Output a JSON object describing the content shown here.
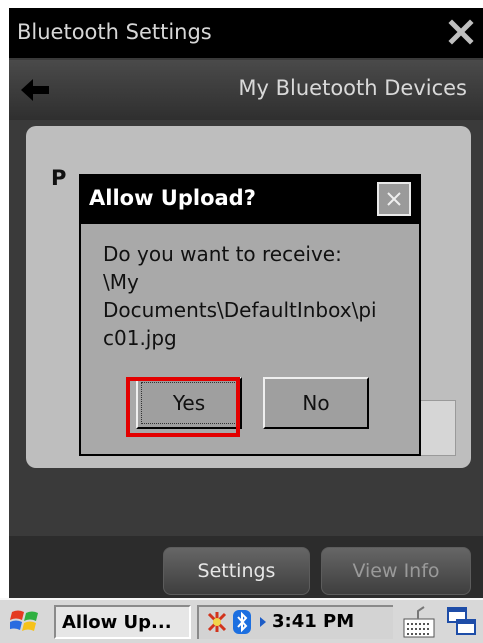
{
  "window": {
    "title": "Bluetooth Settings",
    "close_icon": "close-icon"
  },
  "header": {
    "back_icon": "back-arrow-icon",
    "title": "My Bluetooth Devices"
  },
  "background_panel": {
    "partial_label": "P"
  },
  "dialog": {
    "title": "Allow Upload?",
    "message_lines": [
      "Do you want to receive:",
      "\\My",
      "Documents\\DefaultInbox\\pi",
      "c01.jpg"
    ],
    "yes_label": "Yes",
    "no_label": "No",
    "highlight_color": "#e30000"
  },
  "toolbar": {
    "settings_label": "Settings",
    "viewinfo_label": "View Info"
  },
  "taskbar": {
    "start_icon": "windows-flag-icon",
    "task_label": "Allow Up...",
    "time": "3:41 PM",
    "keyboard_icon": "keyboard-icon",
    "multitask_icon": "windows-switch-icon"
  }
}
